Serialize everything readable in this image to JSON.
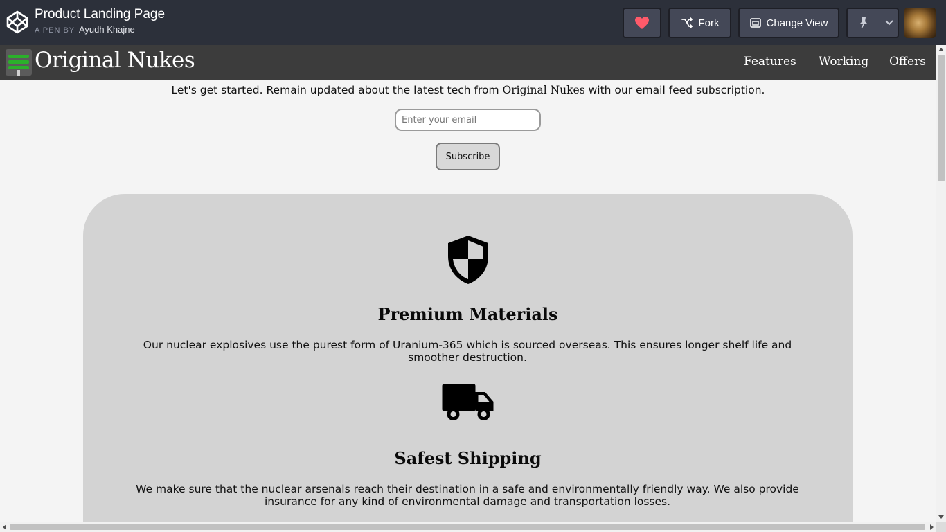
{
  "codepen": {
    "pen_title": "Product Landing Page",
    "byline_prefix": "A PEN BY",
    "author": "Ayudh Khajne",
    "fork_label": "Fork",
    "change_view_label": "Change View",
    "heart_color": "#ff5a6a"
  },
  "nav": {
    "brand": "Original Nukes",
    "links": [
      "Features",
      "Working",
      "Offers"
    ]
  },
  "intro": {
    "text_before": "Let's get started. Remain updated about the latest tech from ",
    "brand_inline": "Original Nukes",
    "text_after": " with our email feed subscription."
  },
  "subscribe": {
    "email_placeholder": "Enter your email",
    "button_label": "Subscribe"
  },
  "features": [
    {
      "icon": "shield-icon",
      "title": "Premium Materials",
      "description": "Our nuclear explosives use the purest form of Uranium-365 which is sourced overseas. This ensures longer shelf life and smoother destruction."
    },
    {
      "icon": "truck-icon",
      "title": "Safest Shipping",
      "description": "We make sure that the nuclear arsenals reach their destination in a safe and environmentally friendly way. We also provide insurance for any kind of environmental damage and transportation losses."
    }
  ]
}
